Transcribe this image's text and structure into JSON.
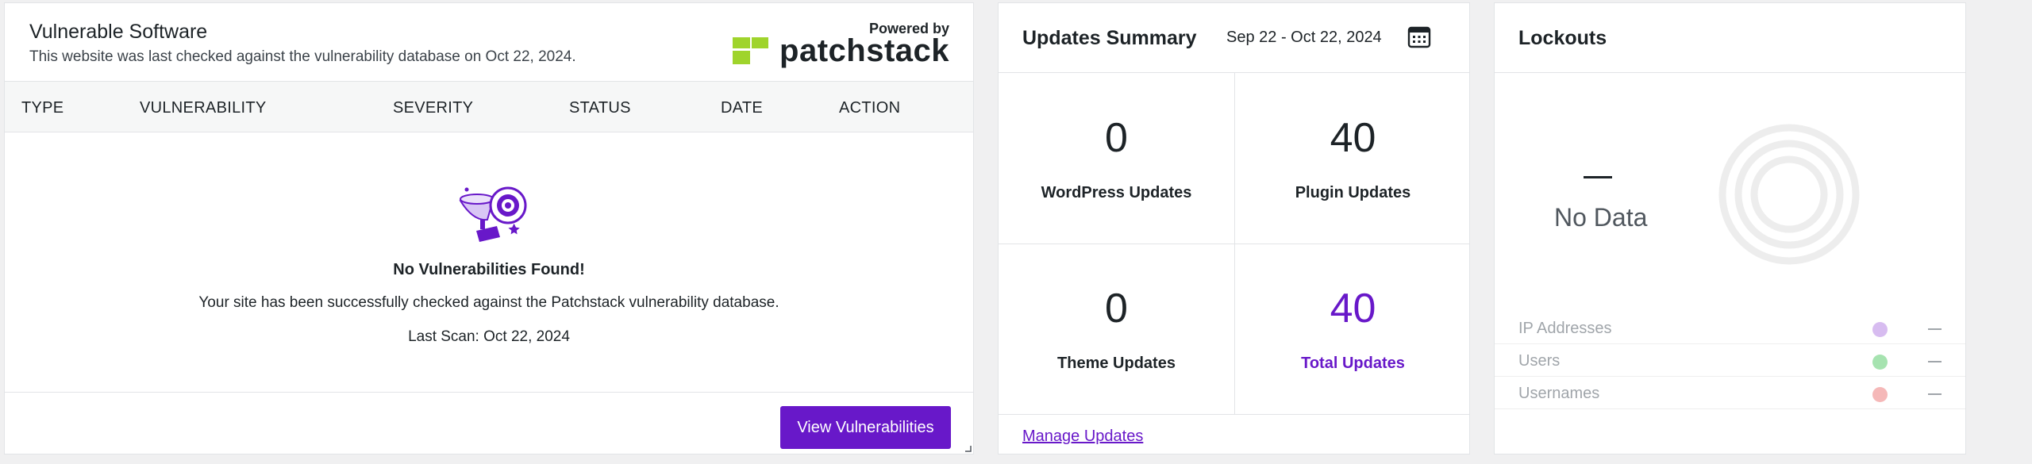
{
  "vulnerable_software": {
    "title": "Vulnerable Software",
    "subtitle": "This website was last checked against the vulnerability database on Oct 22, 2024.",
    "powered_by": "Powered by",
    "logo_text": "patchstack",
    "logo_color": "#9fd42c",
    "columns": [
      "TYPE",
      "VULNERABILITY",
      "SEVERITY",
      "STATUS",
      "DATE",
      "ACTION"
    ],
    "empty_title": "No Vulnerabilities Found!",
    "empty_text": "Your site has been successfully checked against the Patchstack vulnerability database.",
    "last_scan": "Last Scan: Oct 22, 2024",
    "button_label": "View Vulnerabilities",
    "accent": "#6818c9"
  },
  "updates_summary": {
    "title": "Updates Summary",
    "date_range": "Sep 22 - Oct 22, 2024",
    "stats": [
      {
        "value": "0",
        "label": "WordPress Updates"
      },
      {
        "value": "40",
        "label": "Plugin Updates"
      },
      {
        "value": "0",
        "label": "Theme Updates"
      },
      {
        "value": "40",
        "label": "Total Updates"
      }
    ],
    "manage_link": "Manage Updates"
  },
  "lockouts": {
    "title": "Lockouts",
    "value": "—",
    "no_data": "No Data",
    "legend": [
      {
        "label": "IP Addresses",
        "color": "#d7bcf0",
        "value": "—"
      },
      {
        "label": "Users",
        "color": "#a6e3b0",
        "value": "—"
      },
      {
        "label": "Usernames",
        "color": "#f5b8b8",
        "value": "—"
      }
    ]
  }
}
